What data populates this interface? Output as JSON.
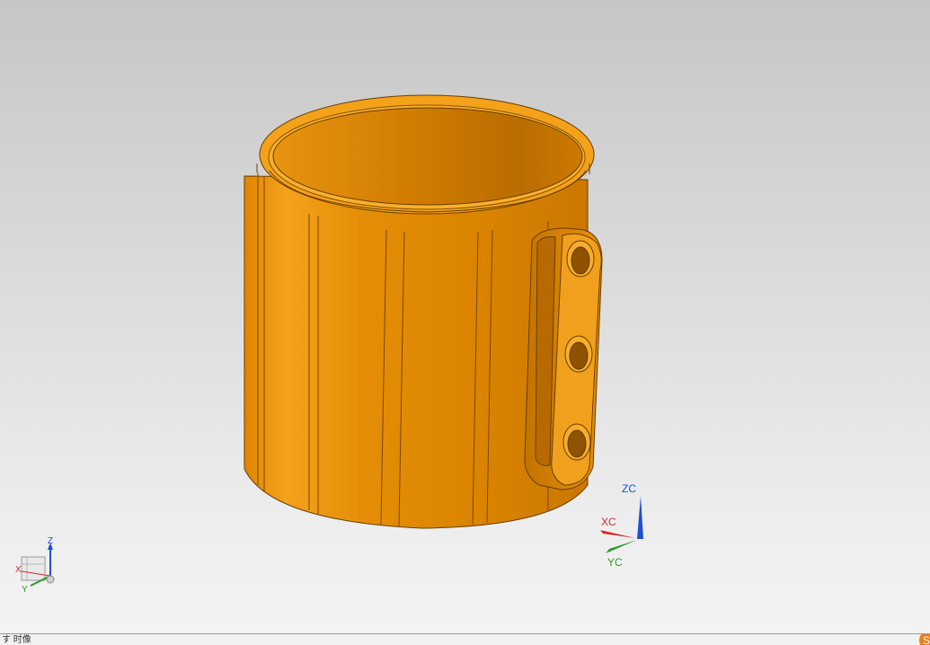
{
  "colors": {
    "part": "#e38a00",
    "part_light": "#f7ac26",
    "part_dark": "#b86a00",
    "edge": "#6a3d00",
    "axis_x": "#d22a2a",
    "axis_y": "#2a9a2a",
    "axis_z": "#1f4fd6"
  },
  "wcs_triad": {
    "x_label": "XC",
    "y_label": "YC",
    "z_label": "ZC"
  },
  "view_triad": {
    "x_label": "X",
    "y_label": "Y",
    "z_label": "Z"
  },
  "status": {
    "text": "す 时像",
    "logo_glyph": "S"
  }
}
